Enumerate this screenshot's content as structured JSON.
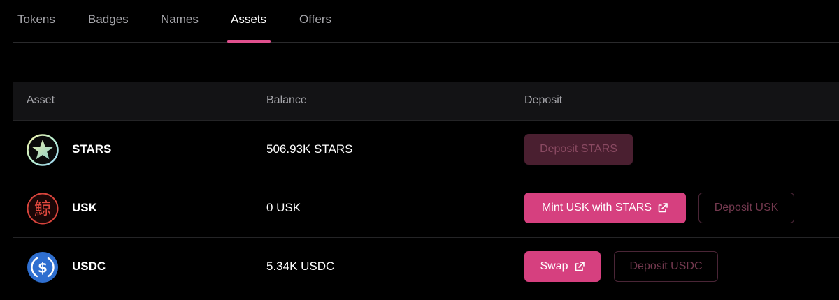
{
  "tabs": [
    {
      "label": "Tokens",
      "active": false
    },
    {
      "label": "Badges",
      "active": false
    },
    {
      "label": "Names",
      "active": false
    },
    {
      "label": "Assets",
      "active": true
    },
    {
      "label": "Offers",
      "active": false
    }
  ],
  "colors": {
    "accent": "#d6407f",
    "tab_underline": "#e0508e",
    "header_bg": "#131315",
    "disabled_button": "#4a1f30"
  },
  "table": {
    "headers": {
      "asset": "Asset",
      "balance": "Balance",
      "deposit": "Deposit"
    },
    "rows": [
      {
        "icon": "stars-token-icon",
        "name": "STARS",
        "balance": "506.93K STARS",
        "primary_action": {
          "label": "Deposit STARS",
          "state": "disabled"
        }
      },
      {
        "icon": "usk-token-icon",
        "icon_glyph": "鯨",
        "name": "USK",
        "balance": "0 USK",
        "primary_action": {
          "label": "Mint USK with STARS",
          "icon": "external-link-icon"
        },
        "secondary_action": {
          "label": "Deposit USK",
          "state": "disabled"
        }
      },
      {
        "icon": "usdc-token-icon",
        "icon_glyph": "$",
        "name": "USDC",
        "balance": "5.34K USDC",
        "primary_action": {
          "label": "Swap",
          "icon": "external-link-icon"
        },
        "secondary_action": {
          "label": "Deposit USDC",
          "state": "disabled"
        }
      }
    ]
  }
}
